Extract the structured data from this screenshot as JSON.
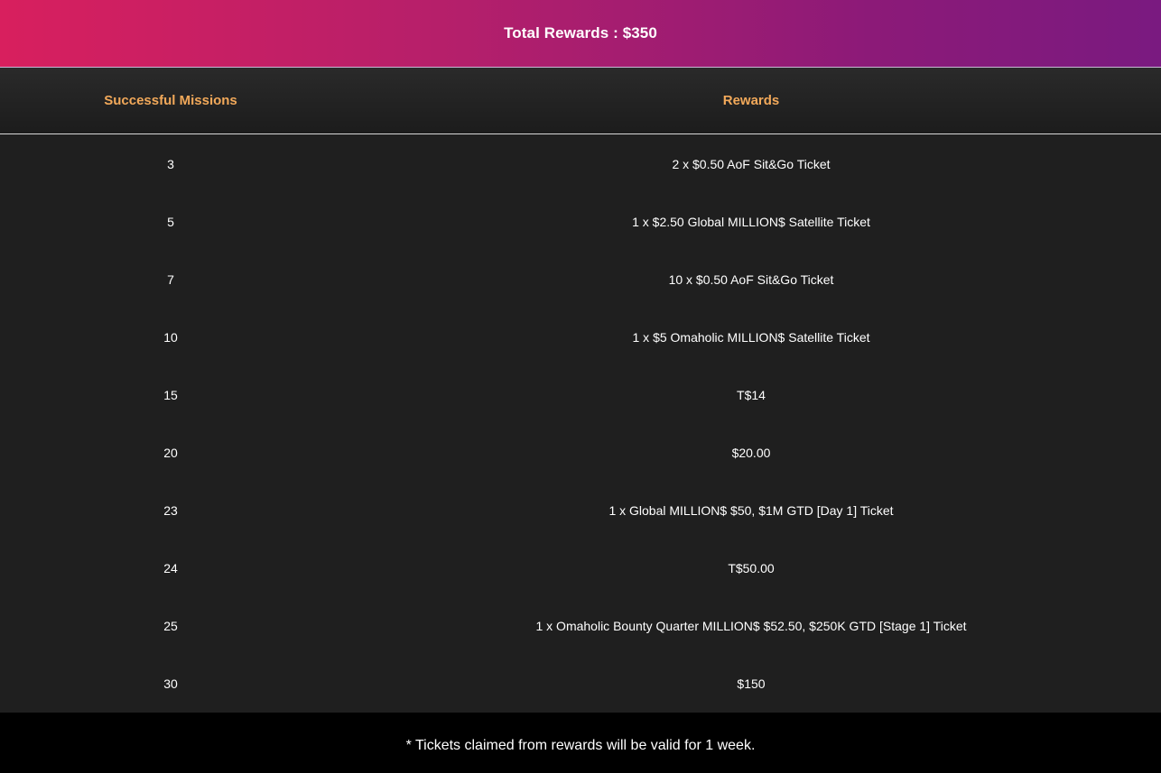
{
  "header": {
    "title": "Total Rewards : $350"
  },
  "table": {
    "columns": [
      "Successful Missions",
      "Rewards"
    ],
    "rows": [
      {
        "missions": "3",
        "reward": "2 x $0.50 AoF Sit&Go Ticket"
      },
      {
        "missions": "5",
        "reward": "1 x $2.50 Global MILLION$ Satellite Ticket"
      },
      {
        "missions": "7",
        "reward": "10 x $0.50 AoF Sit&Go Ticket"
      },
      {
        "missions": "10",
        "reward": "1 x $5 Omaholic MILLION$ Satellite Ticket"
      },
      {
        "missions": "15",
        "reward": "T$14"
      },
      {
        "missions": "20",
        "reward": "$20.00"
      },
      {
        "missions": "23",
        "reward": "1 x Global MILLION$ $50, $1M GTD [Day 1] Ticket"
      },
      {
        "missions": "24",
        "reward": "T$50.00"
      },
      {
        "missions": "25",
        "reward": "1 x Omaholic Bounty Quarter MILLION$ $52.50, $250K GTD [Stage 1] Ticket"
      },
      {
        "missions": "30",
        "reward": "$150"
      }
    ]
  },
  "footer": {
    "note": "* Tickets claimed from rewards will be valid for 1 week."
  },
  "colors": {
    "banner_start": "#d81f5e",
    "banner_end": "#7a1a80",
    "header_text": "#f2a95a",
    "table_bg": "#1f1f1f",
    "footer_bg": "#000000",
    "text": "#ffffff"
  }
}
